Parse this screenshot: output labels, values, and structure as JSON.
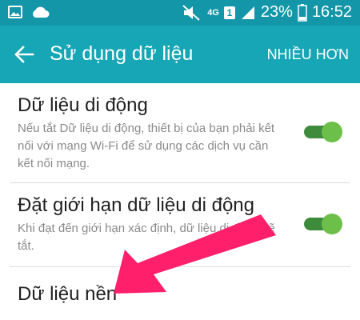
{
  "status_bar": {
    "network": "4G",
    "sim": "1",
    "battery": "23%",
    "time": "16:52",
    "icons": [
      "image-icon",
      "cloud-icon",
      "mute-icon",
      "signal-icon",
      "battery-icon"
    ]
  },
  "app_bar": {
    "title": "Sử dụng dữ liệu",
    "more_label": "NHIỀU HƠN",
    "back_icon": "arrow-left-icon",
    "color": "#16a6b6"
  },
  "settings": [
    {
      "title": "Dữ liệu di động",
      "description": "Nếu tắt Dữ liệu di động, thiết bị của bạn phải kết nối với mạng Wi-Fi để sử dụng các dịch vụ cần kết nối mạng.",
      "enabled": true
    },
    {
      "title": "Đặt giới hạn dữ liệu di động",
      "description": "Khi đạt đến giới hạn xác định, dữ liệu di động sẽ tắt.",
      "enabled": true
    },
    {
      "title": "Dữ liệu nền"
    }
  ],
  "colors": {
    "toggle_on": "#6cc04a",
    "annotation_arrow": "#ff1f6b"
  }
}
